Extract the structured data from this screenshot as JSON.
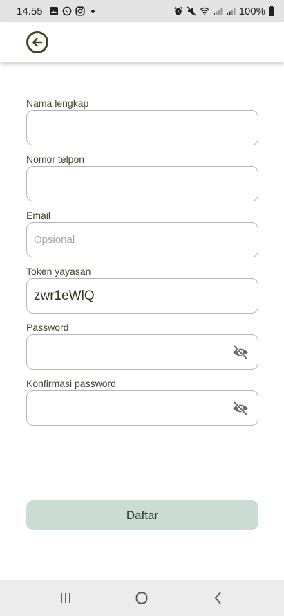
{
  "status_bar": {
    "time": "14.55",
    "battery": "100%",
    "left_icons": [
      "gallery-icon",
      "whatsapp-icon",
      "instagram-icon",
      "dot-icon"
    ],
    "right_icons": [
      "alarm-icon",
      "mute-icon",
      "wifi-icon",
      "signal-icon",
      "signal-icon",
      "battery-icon"
    ]
  },
  "app_bar": {
    "back_icon": "arrow-left-circle-icon"
  },
  "form": {
    "full_name": {
      "label": "Nama lengkap",
      "value": "",
      "placeholder": ""
    },
    "phone": {
      "label": "Nomor telpon",
      "value": "",
      "placeholder": ""
    },
    "email": {
      "label": "Email",
      "value": "",
      "placeholder": "Opsional"
    },
    "token": {
      "label": "Token yayasan",
      "value": "zwr1eWlQ",
      "placeholder": ""
    },
    "password": {
      "label": "Password",
      "value": "",
      "placeholder": "",
      "toggle_icon": "eye-off-icon"
    },
    "confirm_password": {
      "label": "Konfirmasi password",
      "value": "",
      "placeholder": "",
      "toggle_icon": "eye-off-icon"
    }
  },
  "submit": {
    "label": "Daftar"
  },
  "nav_bar": {
    "recents_icon": "recents-icon",
    "home_icon": "home-icon",
    "back_icon": "back-chevron-icon"
  },
  "colors": {
    "accent_dark": "#3b4a20",
    "button_bg": "#c9ddd3",
    "input_border": "#b5b5b5",
    "status_bar_bg": "#e4e4e4",
    "nav_bar_bg": "#ececec"
  }
}
